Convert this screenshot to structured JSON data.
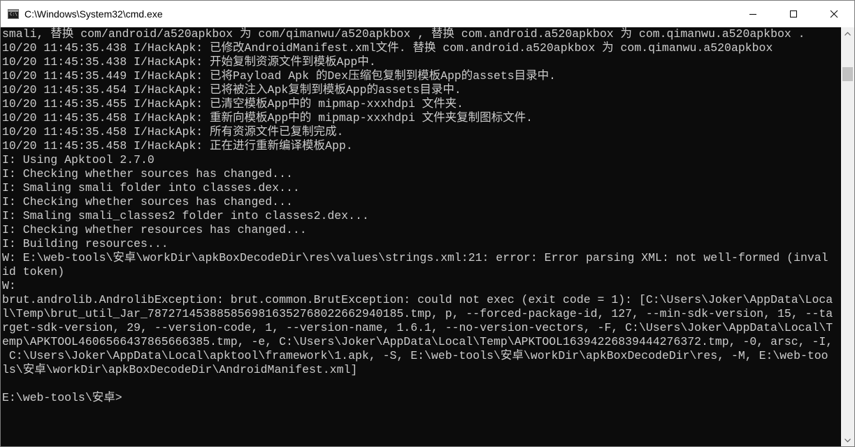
{
  "window": {
    "title": "C:\\Windows\\System32\\cmd.exe"
  },
  "controls": {
    "minimize": "minimize",
    "maximize": "maximize",
    "close": "close"
  },
  "console": {
    "lines": [
      "smali, 替换 com/android/a520apkbox 为 com/qimanwu/a520apkbox , 替换 com.android.a520apkbox 为 com.qimanwu.a520apkbox .",
      "10/20 11:45:35.438 I/HackApk: 已修改AndroidManifest.xml文件. 替换 com.android.a520apkbox 为 com.qimanwu.a520apkbox",
      "10/20 11:45:35.438 I/HackApk: 开始复制资源文件到模板App中.",
      "10/20 11:45:35.449 I/HackApk: 已将Payload Apk 的Dex压缩包复制到模板App的assets目录中.",
      "10/20 11:45:35.454 I/HackApk: 已将被注入Apk复制到模板App的assets目录中.",
      "10/20 11:45:35.455 I/HackApk: 已清空模板App中的 mipmap-xxxhdpi 文件夹.",
      "10/20 11:45:35.458 I/HackApk: 重新向模板App中的 mipmap-xxxhdpi 文件夹复制图标文件.",
      "10/20 11:45:35.458 I/HackApk: 所有资源文件已复制完成.",
      "10/20 11:45:35.458 I/HackApk: 正在进行重新编译模板App.",
      "I: Using Apktool 2.7.0",
      "I: Checking whether sources has changed...",
      "I: Smaling smali folder into classes.dex...",
      "I: Checking whether sources has changed...",
      "I: Smaling smali_classes2 folder into classes2.dex...",
      "I: Checking whether resources has changed...",
      "I: Building resources...",
      "W: E:\\web-tools\\安卓\\workDir\\apkBoxDecodeDir\\res\\values\\strings.xml:21: error: Error parsing XML: not well-formed (inval",
      "id token)",
      "W:",
      "brut.androlib.AndrolibException: brut.common.BrutException: could not exec (exit code = 1): [C:\\Users\\Joker\\AppData\\Loca",
      "l\\Temp\\brut_util_Jar_7872714538858569816352768022662940185.tmp, p, --forced-package-id, 127, --min-sdk-version, 15, --ta",
      "rget-sdk-version, 29, --version-code, 1, --version-name, 1.6.1, --no-version-vectors, -F, C:\\Users\\Joker\\AppData\\Local\\T",
      "emp\\APKTOOL4606566437865666385.tmp, -e, C:\\Users\\Joker\\AppData\\Local\\Temp\\APKTOOL16394226839444276372.tmp, -0, arsc, -I,",
      " C:\\Users\\Joker\\AppData\\Local\\apktool\\framework\\1.apk, -S, E:\\web-tools\\安卓\\workDir\\apkBoxDecodeDir\\res, -M, E:\\web-too",
      "ls\\安卓\\workDir\\apkBoxDecodeDir\\AndroidManifest.xml]",
      "",
      "E:\\web-tools\\安卓>"
    ]
  }
}
